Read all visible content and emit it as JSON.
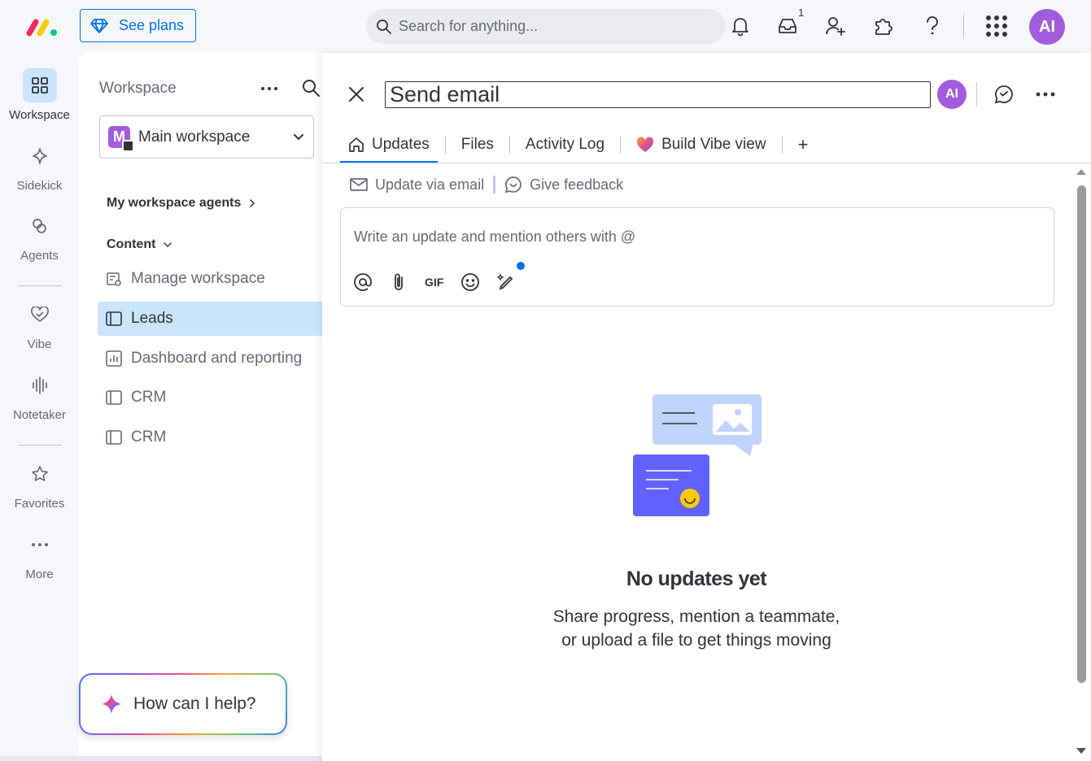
{
  "topbar": {
    "see_plans": "See plans",
    "search_placeholder": "Search for anything...",
    "inbox_count": "1",
    "user_initials": "AI"
  },
  "rail": {
    "items": [
      {
        "label": "Workspace",
        "icon": "workspace-grid-icon"
      },
      {
        "label": "Sidekick",
        "icon": "sparkle-icon"
      },
      {
        "label": "Agents",
        "icon": "agents-icon"
      },
      {
        "label": "Vibe",
        "icon": "vibe-heart-icon"
      },
      {
        "label": "Notetaker",
        "icon": "soundwave-icon"
      },
      {
        "label": "Favorites",
        "icon": "star-icon"
      },
      {
        "label": "More",
        "icon": "more-dots-icon"
      }
    ]
  },
  "workspace": {
    "title": "Workspace",
    "selected": "Main workspace",
    "selected_badge": "M",
    "agents_label": "My workspace agents",
    "content_label": "Content",
    "items": [
      {
        "label": "Manage workspace",
        "icon": "manage-workspace-icon"
      },
      {
        "label": "Leads",
        "icon": "board-icon"
      },
      {
        "label": "Dashboard and reporting",
        "icon": "dashboard-icon"
      },
      {
        "label": "CRM",
        "icon": "board-icon"
      },
      {
        "label": "CRM",
        "icon": "board-icon"
      }
    ],
    "help": "How can I help?"
  },
  "item_panel": {
    "title": "Send email",
    "avatar": "AI",
    "tabs": [
      "Updates",
      "Files",
      "Activity Log",
      "Build Vibe view"
    ],
    "add_tab": "+",
    "update_via_email": "Update via email",
    "give_feedback": "Give feedback",
    "editor_placeholder": "Write an update and mention others with @",
    "gif_label": "GIF",
    "empty_title": "No updates yet",
    "empty_line1": "Share progress, mention a teammate,",
    "empty_line2": "or upload a file to get things moving"
  },
  "colors": {
    "accent": "#0073ea",
    "avatar": "#a25ddc",
    "selected_bg": "#cce5ff"
  }
}
